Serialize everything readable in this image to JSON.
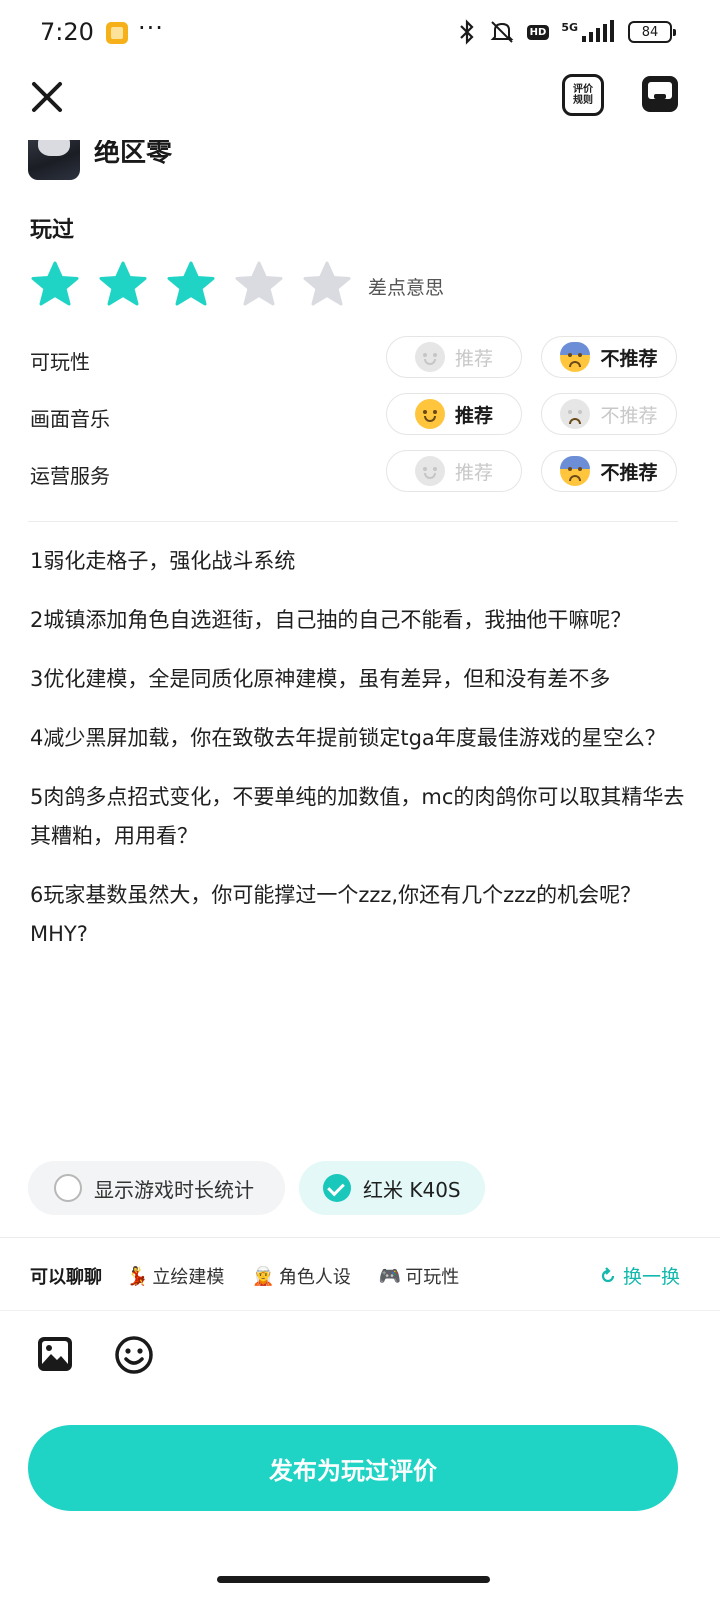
{
  "status_bar": {
    "time": "7:20",
    "more": "···",
    "hd": "HD",
    "network": "5G",
    "battery": "84"
  },
  "header": {
    "close_icon": "close-icon",
    "rules_label": "评价规则",
    "inbox_icon": "inbox-icon"
  },
  "game": {
    "name": "绝区零"
  },
  "played_label": "玩过",
  "rating": {
    "stars_filled": 3,
    "stars_total": 5,
    "text": "差点意思",
    "active_color": "#1fd3c5",
    "inactive_color": "#d9dbe0"
  },
  "aspects": [
    {
      "label": "可玩性",
      "recommend": "推荐",
      "not_recommend": "不推荐",
      "selected": "not_recommend"
    },
    {
      "label": "画面音乐",
      "recommend": "推荐",
      "not_recommend": "不推荐",
      "selected": "recommend"
    },
    {
      "label": "运营服务",
      "recommend": "推荐",
      "not_recommend": "不推荐",
      "selected": "not_recommend"
    }
  ],
  "review": {
    "paragraphs": [
      "1弱化走格子，强化战斗系统",
      "2城镇添加角色自选逛街，自己抽的自己不能看，我抽他干嘛呢？",
      "3优化建模，全是同质化原神建模，虽有差异，但和没有差不多",
      "4减少黑屏加载，你在致敬去年提前锁定tga年度最佳游戏的星空么？",
      "5肉鸽多点招式变化，不要单纯的加数值，mc的肉鸽你可以取其精华去其糟粕，用用看？",
      "6玩家基数虽然大，你可能撑过一个zzz,你还有几个zzz的机会呢？MHY?"
    ]
  },
  "options": {
    "playtime_label": "显示游戏时长统计",
    "playtime_checked": false,
    "device_label": "红米 K40S",
    "device_checked": true
  },
  "topics": {
    "title": "可以聊聊",
    "items": [
      {
        "emoji": "💃",
        "label": "立绘建模"
      },
      {
        "emoji": "🧝",
        "label": "角色人设"
      },
      {
        "emoji": "🎮",
        "label": "可玩性"
      }
    ],
    "swap_label": "换一换"
  },
  "toolbar": {
    "image_icon": "image-icon",
    "emoji_icon": "emoji-icon"
  },
  "publish_label": "发布为玩过评价",
  "accent_color": "#1fd3c5"
}
